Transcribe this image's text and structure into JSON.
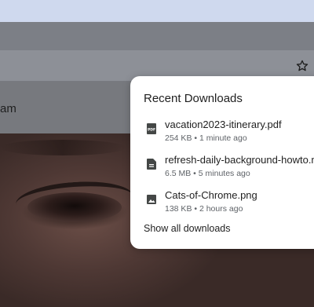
{
  "page": {
    "partial_label": "am"
  },
  "downloads_bubble": {
    "title": "Recent Downloads",
    "items": [
      {
        "name": "vacation2023-itinerary.pdf",
        "meta": "254 KB • 1 minute ago",
        "icon": "pdf-file-icon"
      },
      {
        "name": "refresh-daily-background-howto.mp",
        "meta": "6.5 MB • 5 minutes ago",
        "icon": "document-file-icon"
      },
      {
        "name": "Cats-of-Chrome.png",
        "meta": "138 KB • 2 hours ago",
        "icon": "image-file-icon"
      }
    ],
    "show_all_label": "Show all downloads"
  },
  "colors": {
    "tabstrip": "#cfd9ee",
    "bubble_bg": "#ffffff",
    "text_primary": "#1f1f1f",
    "text_secondary": "#5f6368",
    "icon_color": "#444746"
  }
}
